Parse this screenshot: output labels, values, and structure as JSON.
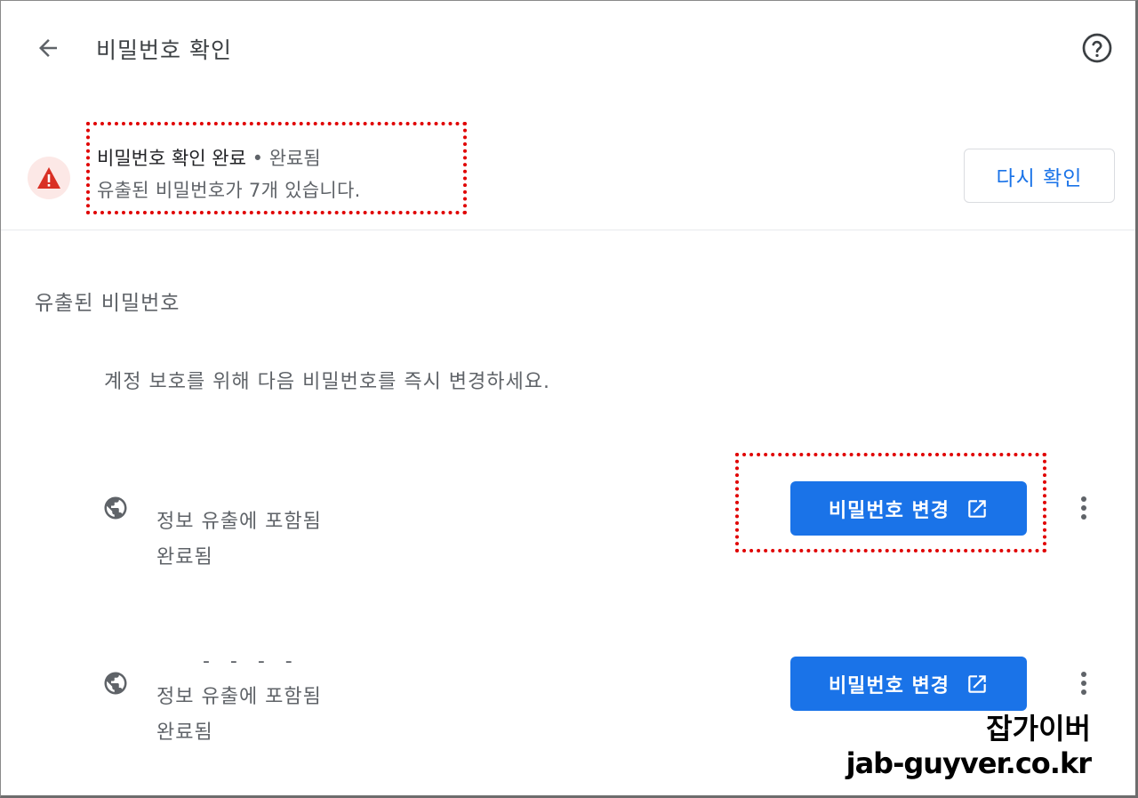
{
  "header": {
    "title": "비밀번호 확인",
    "back_icon": "arrow-back-icon",
    "help_icon": "help-icon"
  },
  "status": {
    "title": "비밀번호 확인 완료",
    "separator": "•",
    "state": "완료됨",
    "detail": "유출된 비밀번호가 7개 있습니다.",
    "recheck_label": "다시 확인",
    "warning_icon": "warning-icon",
    "warning_color": "#d93025"
  },
  "leaked": {
    "section_title": "유출된 비밀번호",
    "description": "계정 보호를 위해 다음 비밀번호를 즉시 변경하세요.",
    "items": [
      {
        "site": "",
        "reason": "정보 유출에 포함됨",
        "state": "완료됨",
        "change_label": "비밀번호 변경"
      },
      {
        "site": "- - - -",
        "reason": "정보 유출에 포함됨",
        "state": "완료됨",
        "change_label": "비밀번호 변경"
      }
    ]
  },
  "watermark": {
    "line1": "잡가이버",
    "line2": "jab-guyver.co.kr"
  },
  "colors": {
    "accent": "#1a73e8",
    "highlight": "#e00000"
  }
}
